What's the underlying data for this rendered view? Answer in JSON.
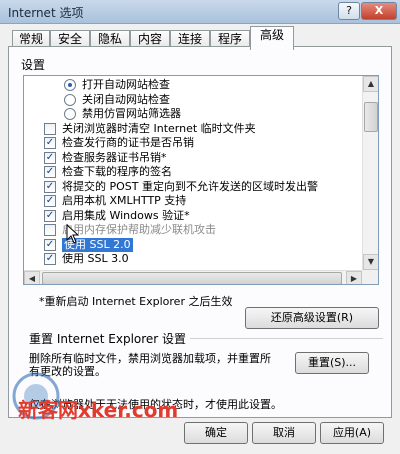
{
  "window": {
    "title": "Internet 选项",
    "help_glyph": "?",
    "close_glyph": "X"
  },
  "tabs": [
    {
      "label": "常规"
    },
    {
      "label": "安全"
    },
    {
      "label": "隐私"
    },
    {
      "label": "内容"
    },
    {
      "label": "连接"
    },
    {
      "label": "程序"
    },
    {
      "label": "高级",
      "active": true
    }
  ],
  "settings": {
    "group_label": "设置",
    "items": [
      {
        "type": "radio",
        "checked": true,
        "indent": 1,
        "label": "打开自动网站检查"
      },
      {
        "type": "radio",
        "checked": false,
        "indent": 1,
        "label": "关闭自动网站检查"
      },
      {
        "type": "radio",
        "checked": false,
        "indent": 1,
        "label": "禁用仿冒网站筛选器"
      },
      {
        "type": "checkbox",
        "checked": false,
        "indent": 0,
        "label": "关闭浏览器时清空 Internet 临时文件夹"
      },
      {
        "type": "checkbox",
        "checked": true,
        "indent": 0,
        "label": "检查发行商的证书是否吊销"
      },
      {
        "type": "checkbox",
        "checked": true,
        "indent": 0,
        "label": "检查服务器证书吊销*"
      },
      {
        "type": "checkbox",
        "checked": true,
        "indent": 0,
        "label": "检查下载的程序的签名"
      },
      {
        "type": "checkbox",
        "checked": true,
        "indent": 0,
        "label": "将提交的 POST 重定向到不允许发送的区域时发出警"
      },
      {
        "type": "checkbox",
        "checked": true,
        "indent": 0,
        "label": "启用本机 XMLHTTP 支持"
      },
      {
        "type": "checkbox",
        "checked": true,
        "indent": 0,
        "label": "启用集成 Windows 验证*"
      },
      {
        "type": "checkbox",
        "checked": false,
        "indent": 0,
        "dim": true,
        "label": "启用内存保护帮助减少联机攻击"
      },
      {
        "type": "checkbox",
        "checked": true,
        "indent": 0,
        "selected": true,
        "label": "使用 SSL 2.0"
      },
      {
        "type": "checkbox",
        "checked": true,
        "indent": 0,
        "label": "使用 SSL 3.0"
      }
    ],
    "restart_note": "*重新启动 Internet Explorer 之后生效",
    "restore_button": "还原高级设置(R)"
  },
  "reset": {
    "title": "重置 Internet Explorer 设置",
    "description": "删除所有临时文件，禁用浏览器加载项，并重置所有更改的设置。",
    "button": "重置(S)...",
    "warning": "仅在浏览器处于无法使用的状态时，才使用此设置。"
  },
  "dialog_buttons": {
    "ok": "确定",
    "cancel": "取消",
    "apply": "应用(A)"
  },
  "watermark": {
    "text": "新客网xker.com",
    "logo_text": "新客"
  },
  "colors": {
    "selection": "#3178d6",
    "watermark_red": "#e23b2e",
    "watermark_blue": "#2f6fb8"
  }
}
